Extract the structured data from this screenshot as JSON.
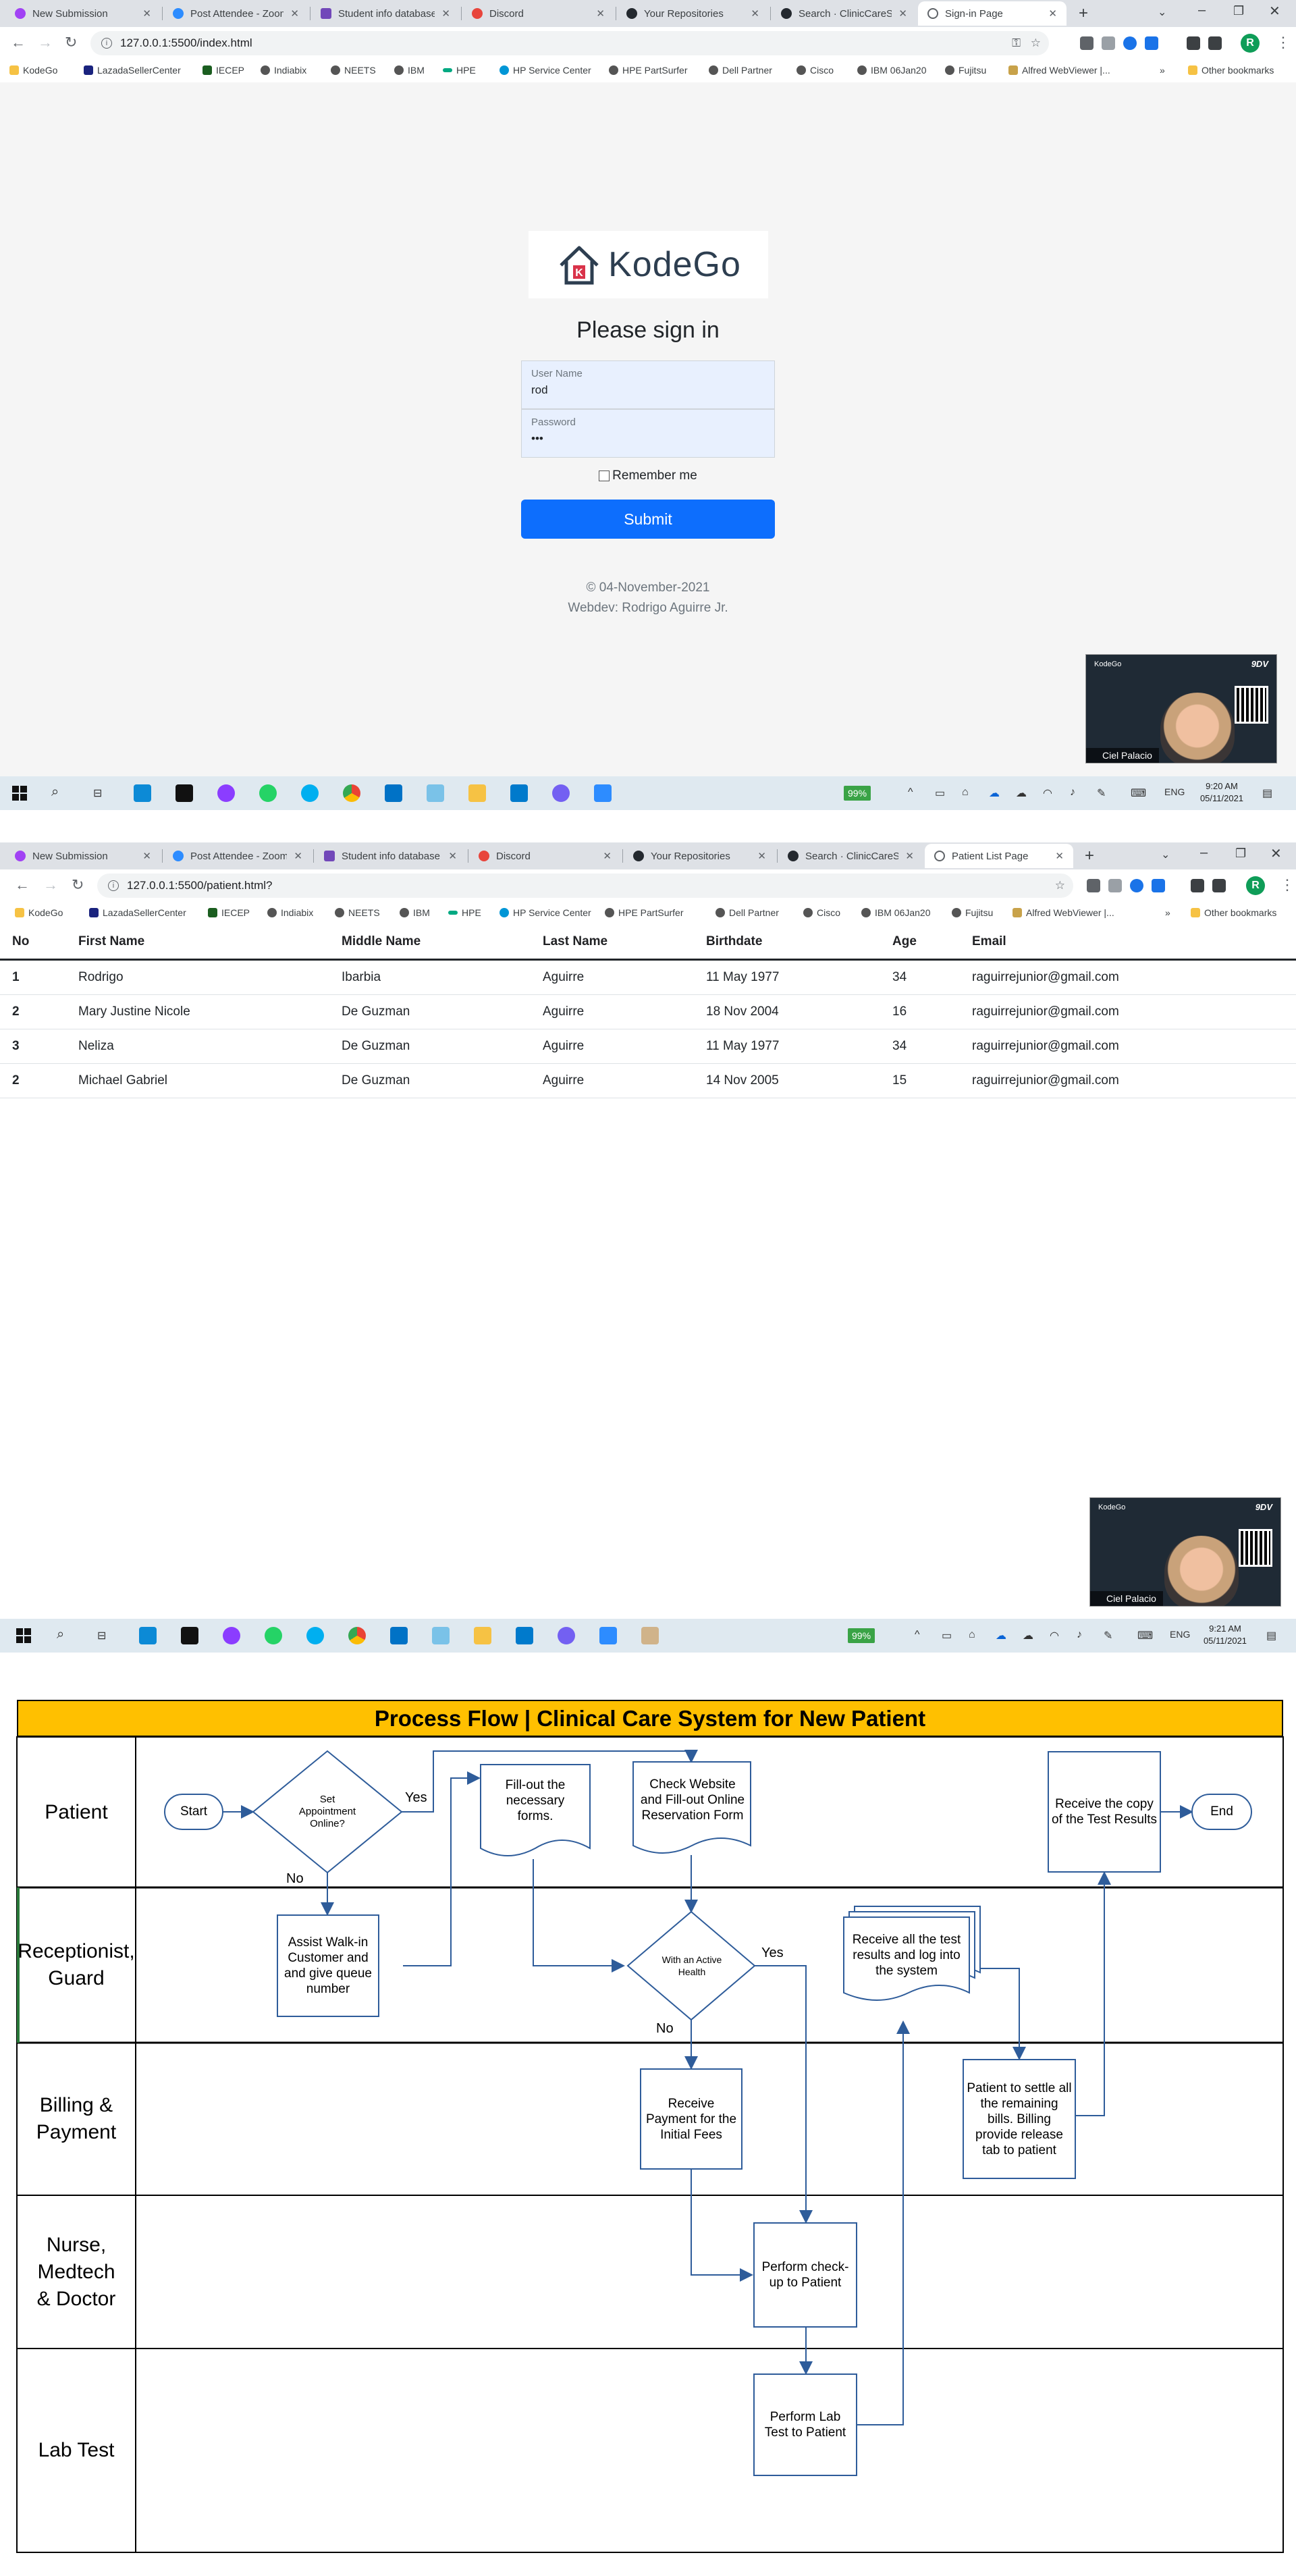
{
  "screen1": {
    "tabs": [
      {
        "label": "New Submission",
        "color": "#a142f4"
      },
      {
        "label": "Post Attendee - Zoom",
        "color": "#2d8cff"
      },
      {
        "label": "Student info database",
        "color": "#7248b9"
      },
      {
        "label": "Discord",
        "color": "#e8453c"
      },
      {
        "label": "Your Repositories",
        "color": "#24292f"
      },
      {
        "label": "Search · ClinicCareSy",
        "color": "#24292f"
      },
      {
        "label": "Sign-in Page",
        "color": "#5f6368"
      }
    ],
    "url": "127.0.0.1:5500/index.html",
    "login": {
      "logo": "KodeGo",
      "title": "Please sign in",
      "username_label": "User Name",
      "username_value": "rod",
      "password_label": "Password",
      "password_value": "•••",
      "remember": "Remember me",
      "submit": "Submit",
      "copyright": "© 04-November-2021",
      "webdev": "Webdev: Rodrigo Aguirre Jr."
    },
    "camera_name": "Ciel Palacio",
    "clock_time": "9:20 AM",
    "clock_date": "05/11/2021"
  },
  "bookmarks": [
    "KodeGo",
    "LazadaSellerCenter",
    "IECEP",
    "Indiabix",
    "NEETS",
    "IBM",
    "HPE",
    "HP Service Center",
    "HPE PartSurfer",
    "Dell Partner",
    "Cisco",
    "IBM 06Jan20",
    "Fujitsu",
    "Alfred WebViewer |...",
    "Other bookmarks"
  ],
  "camera": {
    "logo": "KodeGo",
    "brand": "9DV"
  },
  "taskbar": {
    "battery": "99%",
    "lang": "ENG"
  },
  "screen2": {
    "tabs": [
      {
        "label": "New Submission",
        "color": "#a142f4"
      },
      {
        "label": "Post Attendee - Zoom",
        "color": "#2d8cff"
      },
      {
        "label": "Student info database",
        "color": "#7248b9"
      },
      {
        "label": "Discord",
        "color": "#e8453c"
      },
      {
        "label": "Your Repositories",
        "color": "#24292f"
      },
      {
        "label": "Search · ClinicCareSy",
        "color": "#24292f"
      },
      {
        "label": "Patient List Page",
        "color": "#5f6368"
      }
    ],
    "url": "127.0.0.1:5500/patient.html?",
    "columns": [
      "No",
      "First Name",
      "Middle Name",
      "Last Name",
      "Birthdate",
      "Age",
      "Email"
    ],
    "rows": [
      [
        "1",
        "Rodrigo",
        "Ibarbia",
        "Aguirre",
        "11 May 1977",
        "34",
        "raguirrejunior@gmail.com"
      ],
      [
        "2",
        "Mary Justine Nicole",
        "De Guzman",
        "Aguirre",
        "18 Nov 2004",
        "16",
        "raguirrejunior@gmail.com"
      ],
      [
        "3",
        "Neliza",
        "De Guzman",
        "Aguirre",
        "11 May 1977",
        "34",
        "raguirrejunior@gmail.com"
      ],
      [
        "2",
        "Michael Gabriel",
        "De Guzman",
        "Aguirre",
        "14 Nov 2005",
        "15",
        "raguirrejunior@gmail.com"
      ]
    ],
    "camera_name": "Ciel Palacio",
    "clock_time": "9:21 AM",
    "clock_date": "05/11/2021"
  },
  "flow": {
    "title": "Process Flow | Clinical Care System for New Patient",
    "lanes": [
      "Patient",
      "Receptionist, Guard",
      "Billing & Payment",
      "Nurse, Medtech & Doctor",
      "Lab Test"
    ],
    "start": "Start",
    "end": "End",
    "set_appointment": "Set Appointment Online?",
    "yes": "Yes",
    "no": "No",
    "fill_forms": "Fill-out the necessary forms.",
    "check_website": "Check Website and Fill-out Online Reservation Form",
    "receive_copy": "Receive the copy of the Test Results",
    "assist_walkin": "Assist Walk-in Customer and and give queue number",
    "active_health": "With an Active Health",
    "receive_results": "Receive all the test results and log into the system",
    "receive_payment": "Receive Payment for the Initial Fees",
    "settle_bills": "Patient to settle all the remaining bills. Billing provide release tab to patient",
    "checkup": "Perform check-up to Patient",
    "lab_test": "Perform Lab Test to Patient",
    "line_color": "#2e5c9a",
    "title_color": "#ffc000"
  }
}
